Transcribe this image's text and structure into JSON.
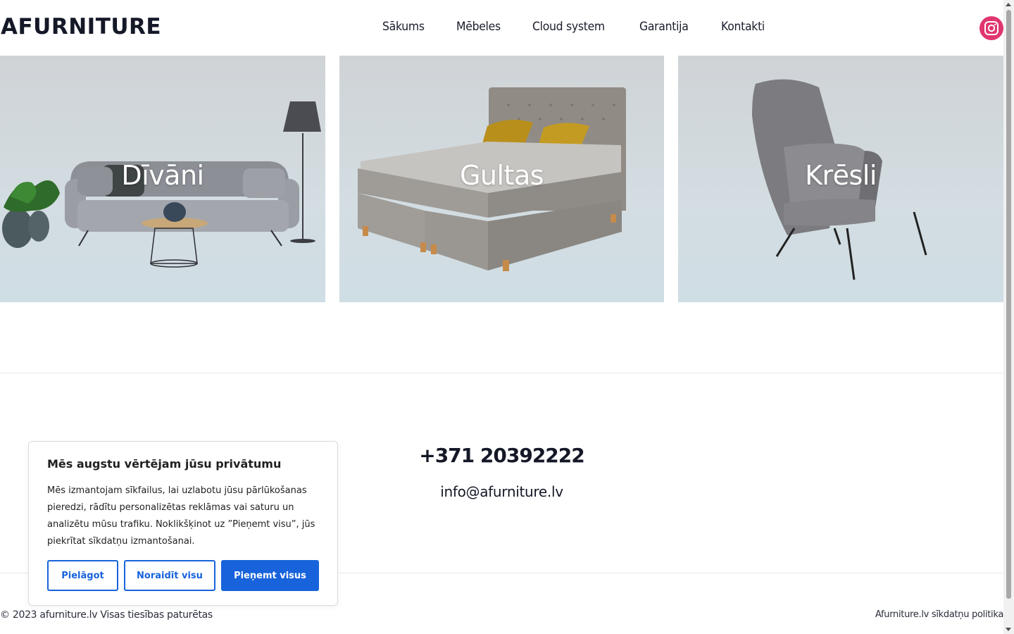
{
  "header": {
    "logo": "AFURNITURE",
    "nav": [
      "Sākums",
      "Mēbeles",
      "Cloud system",
      "Garantija",
      "Kontakti"
    ],
    "social_icon": "instagram-icon",
    "social_color": "#e0356f"
  },
  "categories": [
    {
      "label": "Dīvāni",
      "icon": "sofa-image"
    },
    {
      "label": "Gultas",
      "icon": "bed-image"
    },
    {
      "label": "Krēsli",
      "icon": "armchair-image"
    }
  ],
  "contacts": {
    "phone": "+371 20392222",
    "email": "info@afurniture.lv"
  },
  "footer": {
    "copyright": "© 2023 afurniture.lv Visas tiesības paturētas",
    "cookie_policy": "Afurniture.lv sīkdatņu politika"
  },
  "consent": {
    "title": "Mēs augstu vērtējam jūsu privātumu",
    "text": "Mēs izmantojam sīkfailus, lai uzlabotu jūsu pārlūkošanas pieredzi, rādītu personalizētas reklāmas vai saturu un analizētu mūsu trafiku. Noklikšķinot uz ”Pieņemt visu”, jūs piekrītat sīkdatņu izmantošanai.",
    "customize": "Pielāgot",
    "reject": "Noraidīt visu",
    "accept": "Pieņemt visus",
    "accent_color": "#1863dc"
  }
}
